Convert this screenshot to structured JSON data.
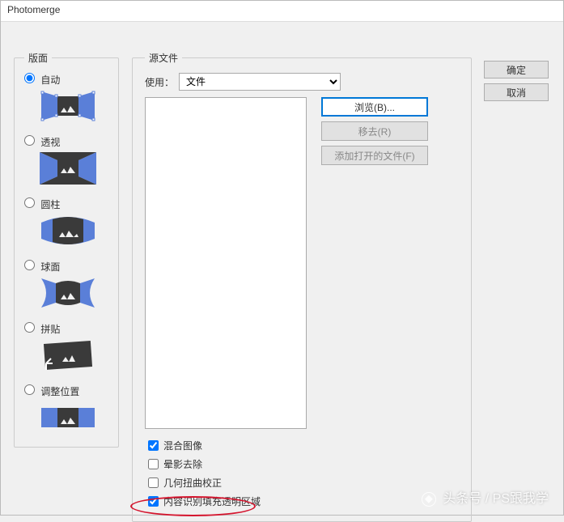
{
  "window": {
    "title": "Photomerge"
  },
  "buttons": {
    "ok": "确定",
    "cancel": "取消"
  },
  "layout": {
    "legend": "版面",
    "options": [
      {
        "value": "auto",
        "label": "自动",
        "checked": true
      },
      {
        "value": "perspective",
        "label": "透视",
        "checked": false
      },
      {
        "value": "cylindrical",
        "label": "圆柱",
        "checked": false
      },
      {
        "value": "spherical",
        "label": "球面",
        "checked": false
      },
      {
        "value": "collage",
        "label": "拼贴",
        "checked": false
      },
      {
        "value": "reposition",
        "label": "调整位置",
        "checked": false
      }
    ]
  },
  "source": {
    "legend": "源文件",
    "use_label": "使用：",
    "use_value": "文件",
    "browse": "浏览(B)...",
    "remove": "移去(R)",
    "add_open": "添加打开的文件(F)"
  },
  "checks": {
    "blend": {
      "label": "混合图像",
      "checked": true
    },
    "vignette": {
      "label": "晕影去除",
      "checked": false
    },
    "geometric": {
      "label": "几何扭曲校正",
      "checked": false
    },
    "caf": {
      "label": "内容识别填充透明区域",
      "checked": true
    }
  },
  "watermark": "头条号 / PS跟我学"
}
